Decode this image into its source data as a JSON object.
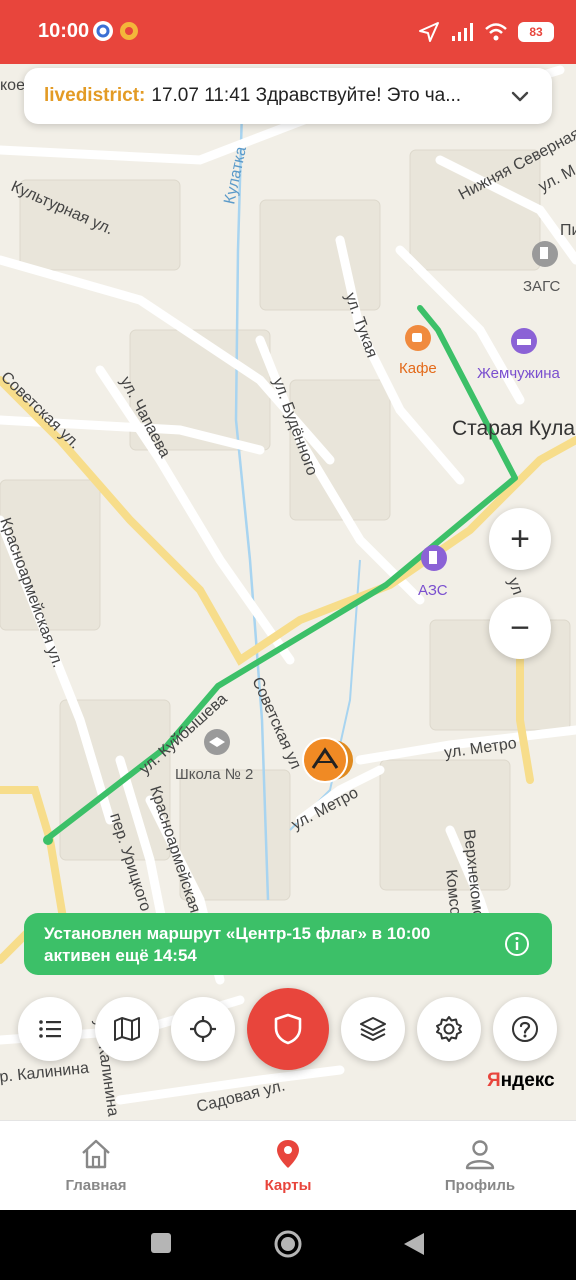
{
  "status_bar": {
    "time": "10:00",
    "battery": "83",
    "icons": [
      "notification-app-icon",
      "notification-app2-icon",
      "location-arrow-icon",
      "signal-icon",
      "wifi-icon",
      "battery-icon"
    ]
  },
  "notification": {
    "source": "livedistrict:",
    "text": "17.07 11:41 Здравствуйте! Это ча...",
    "icon": "chevron-down-icon"
  },
  "map": {
    "labels": {
      "kulturnaya": "Культурная ул.",
      "kulatka": "Кулатка",
      "tukaya": "ул. Тукая",
      "nizhnyaya_severnaya": "Нижняя Северная ул.",
      "zags": "ЗАГС",
      "cafe": "Кафе",
      "zhemchuzhina": "Жемчужина",
      "staraya_kulatka": "Старая Кула",
      "chapaeva": "ул. Чапаева",
      "budennogo": "ул. Будённого",
      "sovetskaya_top": "Советская ул.",
      "krasnoarmeiskaya_left": "Красноармейская ул.",
      "azs": "АЗС",
      "kuibysheva": "ул. Куйбышева",
      "sovetskaya_mid": "Советская ул",
      "shkola": "Школа № 2",
      "metro_right": "ул. Метро",
      "metro_mid": "ул. Метро",
      "uritskogo": "пер. Урицкого",
      "krasnoarmeiskaya_mid": "Красноармейская ул.",
      "verhnekomsomolskaya": "Верхнекомс",
      "komso": "Комсо",
      "kalinina": "р. Калинина",
      "kalinina_vert": "ул. Калинина",
      "sadovaya": "Садовая ул.",
      "edge_koe": "кое",
      "edge_ul": "ул",
      "edge_pi": "Пи",
      "edge_m": "ул. М"
    },
    "colors": {
      "background": "#f2efe7",
      "route": "#3cc068",
      "main_road": "#f7dd8b",
      "street": "#ffffff",
      "river": "#a8d4f0"
    }
  },
  "zoom": {
    "plus": "+",
    "minus": "−"
  },
  "route_banner": {
    "line1": "Установлен маршрут «Центр-15 флаг» в 10:00",
    "line2": "активен ещё 14:54"
  },
  "toolbar": {
    "buttons": [
      "list-icon",
      "map-icon",
      "locate-icon",
      "shield-icon",
      "layers-icon",
      "settings-icon",
      "help-icon"
    ]
  },
  "brand": {
    "first": "Я",
    "rest": "ндекс"
  },
  "tabs": [
    {
      "label": "Главная",
      "icon": "home-icon"
    },
    {
      "label": "Карты",
      "icon": "map-pin-icon"
    },
    {
      "label": "Профиль",
      "icon": "profile-icon"
    }
  ],
  "accent_color": "#e8453c"
}
